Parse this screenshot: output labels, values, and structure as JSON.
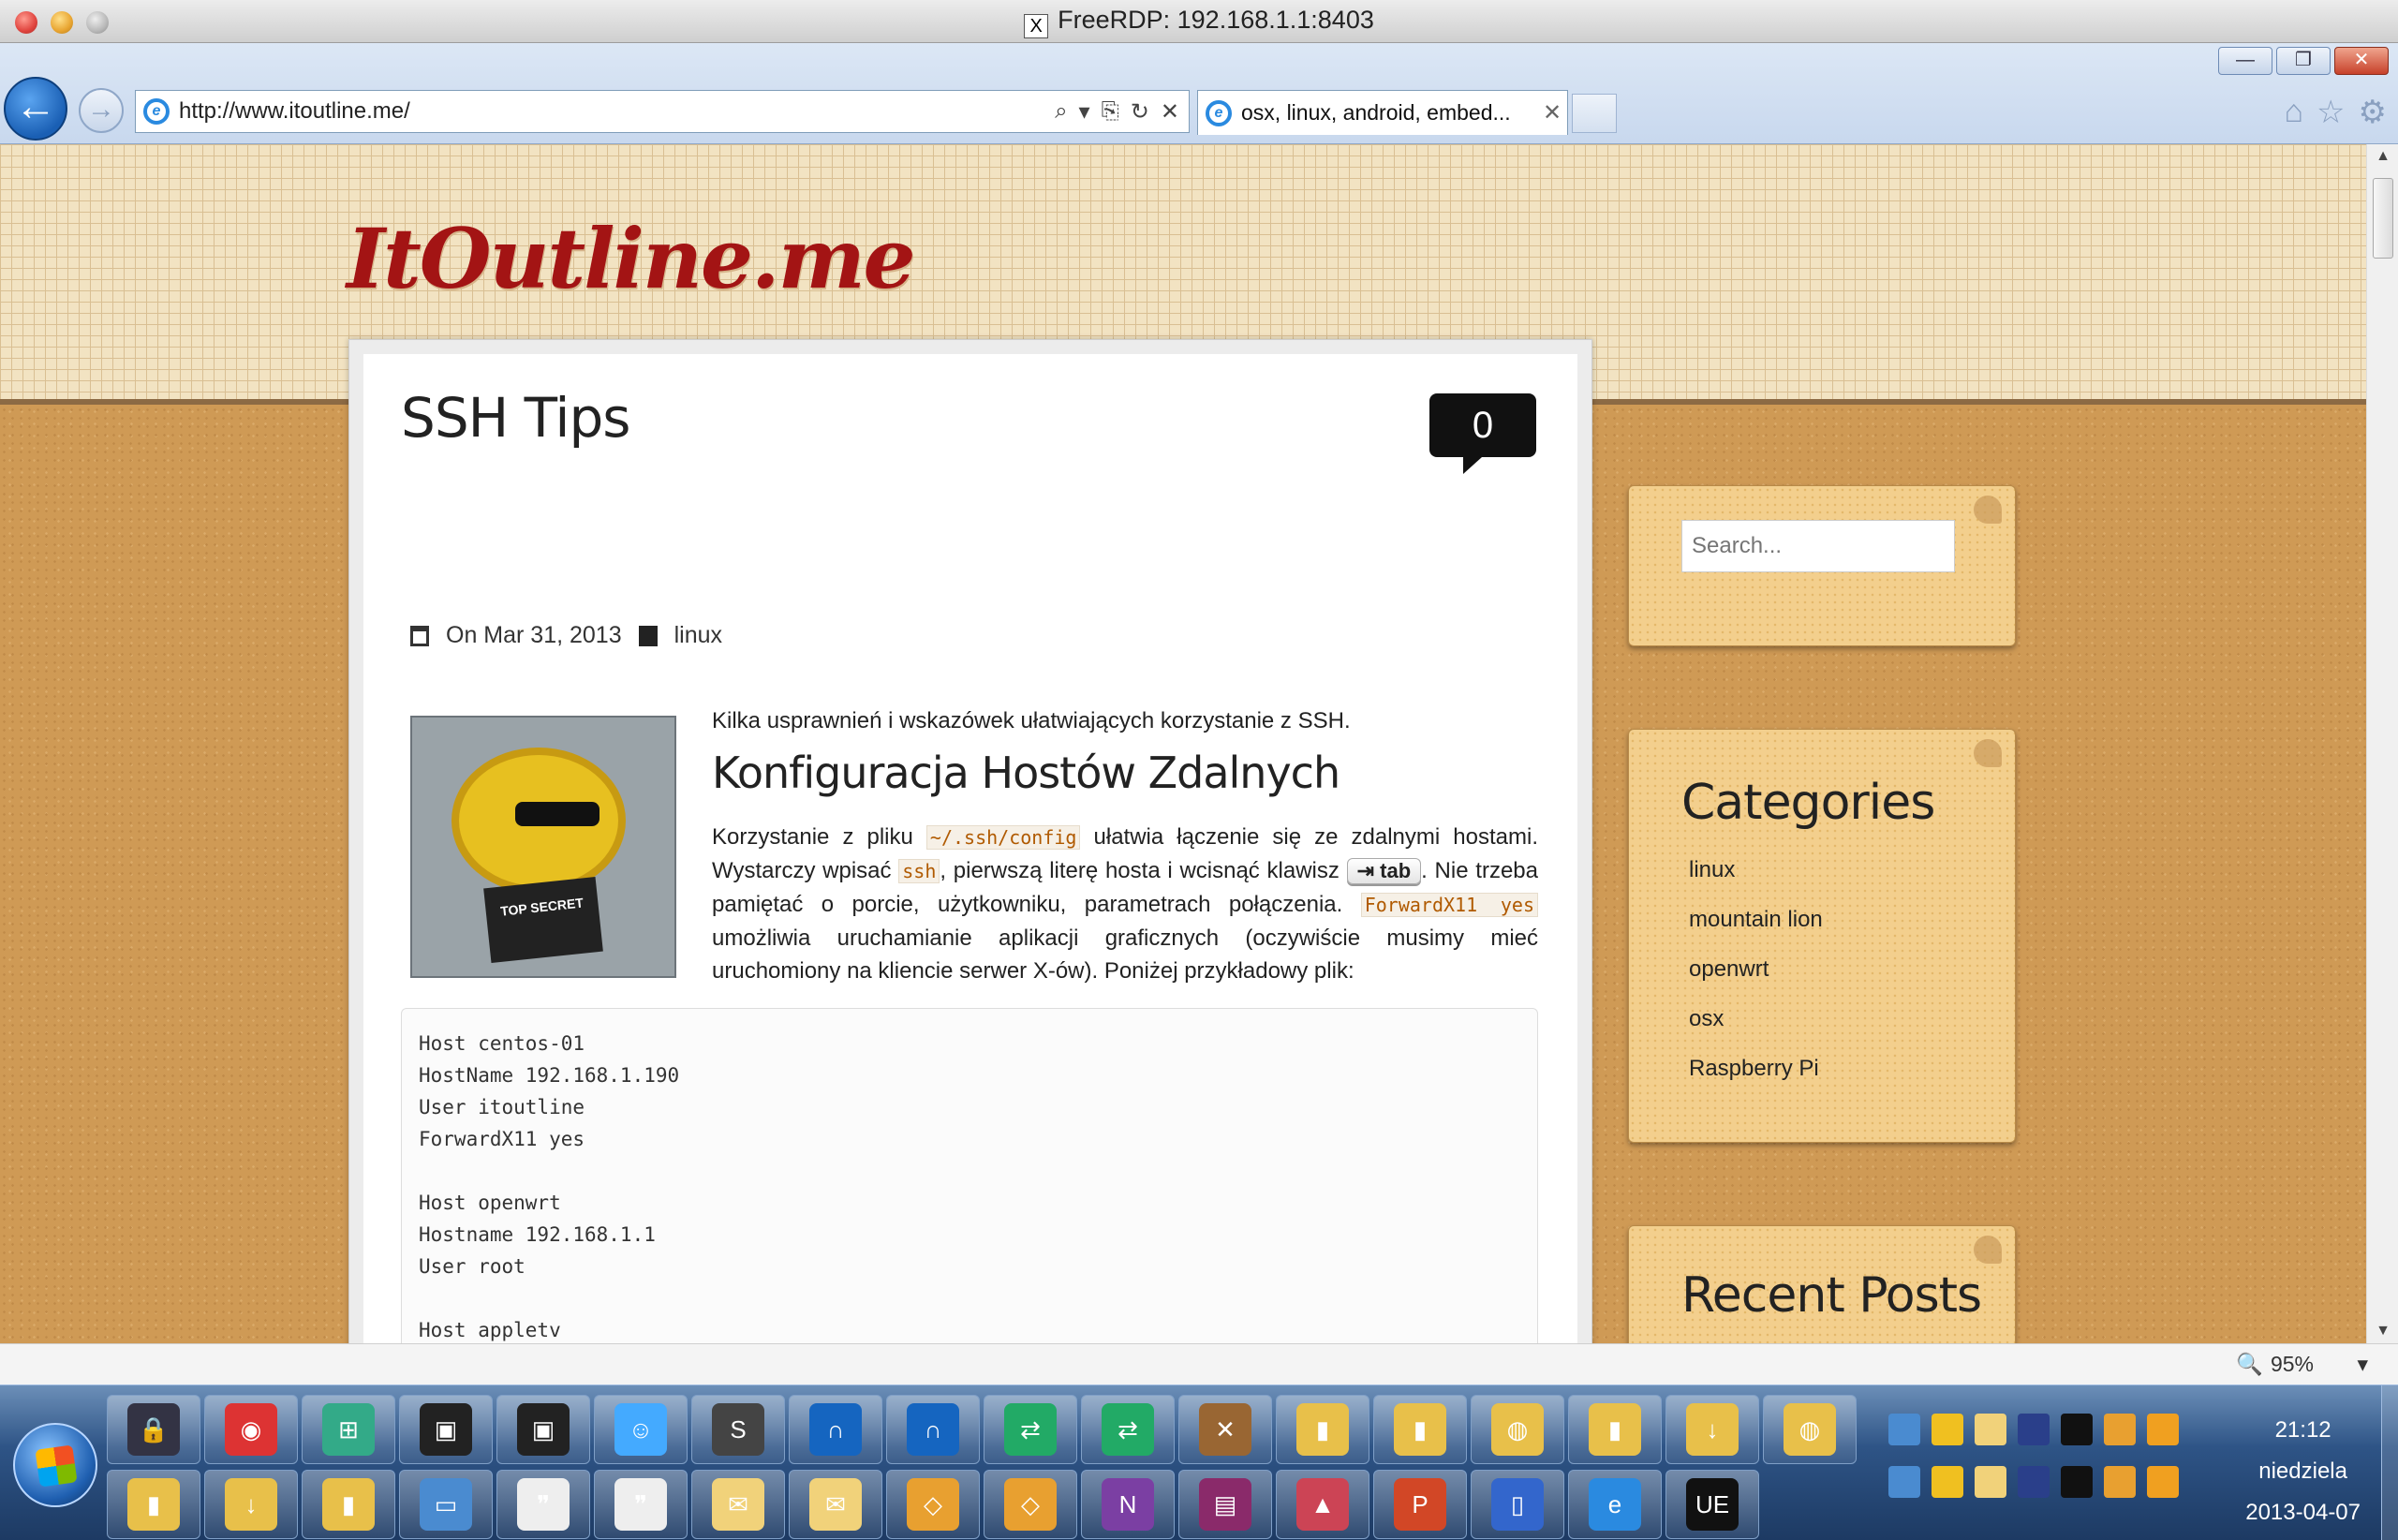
{
  "window": {
    "title": "FreeRDP: 192.168.1.1:8403",
    "x_icon": "X"
  },
  "browser": {
    "address": "http://www.itoutline.me/",
    "tab_title": "osx, linux, android, embed...",
    "tab_close": "✕",
    "back_glyph": "←",
    "fwd_glyph": "→",
    "win_min": "—",
    "win_restore": "❐",
    "win_close": "✕",
    "zoom": "95%",
    "zoom_dropdown": "▾",
    "addr_icons": {
      "search": "⌕",
      "dropdown": "▾",
      "compat": "⎘",
      "refresh": "↻",
      "stop": "✕"
    },
    "right_icons": {
      "home": "⌂",
      "favorites": "☆",
      "tools": "⚙"
    }
  },
  "site": {
    "title": "ItOutline.me"
  },
  "post": {
    "title": "SSH Tips",
    "comments": "0",
    "date": "On Mar 31, 2013",
    "category": "linux",
    "intro": "Kilka usprawnień i wskazówek ułatwiających korzystanie z SSH.",
    "heading": "Konfiguracja Hostów Zdalnych",
    "p1": "Korzystanie z pliku ",
    "code1": "~/.ssh/config",
    "p2": " ułatwia łączenie się ze zdalnymi hostami. Wystarczy wpisać ",
    "code2": "ssh",
    "p3": ", pierwszą literę hosta i wcisnąć klawisz ",
    "kbd": "⇥ tab",
    "p4": ". Nie trzeba pamiętać o porcie, użytkowniku, parametrach połączenia. ",
    "code3": "ForwardX11 yes",
    "p5": " umożliwia uruchamianie aplikacji graficznych (oczywiście musimy mieć uruchomiony na kliencie serwer X-ów). Poniżej przykładowy plik:",
    "image_text": "TOP SECRET",
    "code_block": "Host centos-01\nHostName 192.168.1.190\nUser itoutline\nForwardX11 yes\n\nHost openwrt\nHostname 192.168.1.1\nUser root\n\nHost appletv"
  },
  "sidebar": {
    "search_placeholder": "Search...",
    "categories_title": "Categories",
    "categories": [
      "linux",
      "mountain lion",
      "openwrt",
      "osx",
      "Raspberry Pi"
    ],
    "recent_title": "Recent Posts"
  },
  "taskbar": {
    "clock_time": "21:12",
    "clock_day": "niedziela",
    "clock_date": "2013-04-07",
    "row1_icons": [
      "keepass-icon",
      "chrome-icon",
      "windows-update-icon",
      "terminal-icon",
      "terminal-icon",
      "finder-icon",
      "sublime-text-icon",
      "wireshark-icon",
      "wireshark-icon",
      "network-icon",
      "network-icon",
      "tools-icon",
      "folder-icon",
      "folder-icon",
      "folder-network-icon",
      "folder-icon",
      "folder-download-icon",
      "folder-network-icon"
    ],
    "row2_icons": [
      "folder-icon",
      "folder-download-icon",
      "folder-icon",
      "remote-desktop-icon",
      "speech-icon",
      "speech-icon",
      "mail-icon",
      "mail-icon",
      "virtualbox-icon",
      "virtualbox-icon",
      "onenote-icon",
      "winrar-icon",
      "unity-icon",
      "powerpoint-icon",
      "network-share-icon",
      "internet-explorer-icon",
      "ultraedit-icon"
    ],
    "tray_row1": [
      "ie-tray-icon",
      "sun-icon",
      "mail-tray-icon",
      "lock-tray-icon",
      "terminal-tray-icon",
      "sync-icon",
      "outlook-icon"
    ],
    "tray_row2": [
      "onenote-tray-icon",
      "keyboard-icon",
      "flag-icon",
      "user-icon",
      "network-tray-icon",
      "volume-mute-icon",
      "dropbox-icon"
    ],
    "task_glyphs": {
      "keepass-icon": "🔒",
      "chrome-icon": "◉",
      "windows-update-icon": "⊞",
      "terminal-icon": "▣",
      "finder-icon": "☺",
      "sublime-text-icon": "S",
      "wireshark-icon": "∩",
      "network-icon": "⇄",
      "tools-icon": "✕",
      "folder-icon": "▮",
      "folder-network-icon": "◍",
      "folder-download-icon": "↓",
      "remote-desktop-icon": "▭",
      "speech-icon": "❞",
      "mail-icon": "✉",
      "virtualbox-icon": "◇",
      "onenote-icon": "N",
      "winrar-icon": "▤",
      "unity-icon": "▲",
      "powerpoint-icon": "P",
      "network-share-icon": "▯",
      "internet-explorer-icon": "e",
      "ultraedit-icon": "UE"
    }
  },
  "colors": {
    "site_title": "#a31414",
    "page_bg": "#cf9a55",
    "widget_bg": "#f3cf8d",
    "code_accent": "#b05a00"
  }
}
